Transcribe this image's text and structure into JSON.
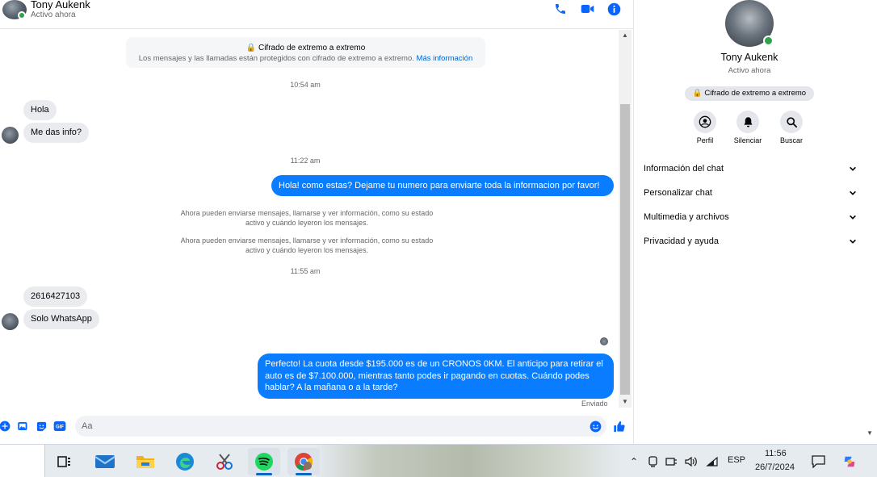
{
  "contact": {
    "name": "Tony Aukenk",
    "status": "Activo ahora"
  },
  "encryption": {
    "title": "Cifrado de extremo a extremo",
    "body": "Los mensajes y las llamadas están protegidos con cifrado de extremo a extremo.",
    "link": "Más información"
  },
  "messages": {
    "time1": "10:54 am",
    "in1": "Hola",
    "in2": "Me das info?",
    "time2": "11:22 am",
    "out1": "Hola! como estas? Dejame tu numero para enviarte toda la informacion por favor!",
    "sys1_line1": "Ahora pueden enviarse mensajes, llamarse y ver información, como su estado",
    "sys1_line2": "activo y cuándo leyeron los mensajes.",
    "sys2_line1": "Ahora pueden enviarse mensajes, llamarse y ver información, como su estado",
    "sys2_line2": "activo y cuándo leyeron los mensajes.",
    "time3": "11:55 am",
    "in3": "2616427103",
    "in4": "Solo WhatsApp",
    "out2_line1": "Perfecto! La cuota desde $195.000 es de un CRONOS 0KM. El anticipo para retirar el",
    "out2_line2": "auto es de $7.100.000, mientras tanto podes ir pagando en cuotas. Cuándo podes",
    "out2_line3": "hablar? A la mañana o a la tarde?",
    "sent_label": "Enviado"
  },
  "composer": {
    "placeholder": "Aa"
  },
  "panel": {
    "name": "Tony Aukenk",
    "status": "Activo ahora",
    "encryption_badge": "Cifrado de extremo a extremo",
    "actions": {
      "profile": "Perfil",
      "mute": "Silenciar",
      "search": "Buscar"
    },
    "sections": {
      "chat_info": "Información del chat",
      "customize": "Personalizar chat",
      "media": "Multimedia y archivos",
      "privacy": "Privacidad y ayuda"
    }
  },
  "taskbar": {
    "language": "ESP",
    "time": "11:56",
    "date": "26/7/2024",
    "apps": [
      "task-view",
      "mail",
      "file-explorer",
      "edge",
      "snipping-tool",
      "spotify",
      "chrome"
    ]
  },
  "colors": {
    "accent": "#0a7cff",
    "icon_blue": "#0866ff",
    "online": "#31a24c"
  }
}
